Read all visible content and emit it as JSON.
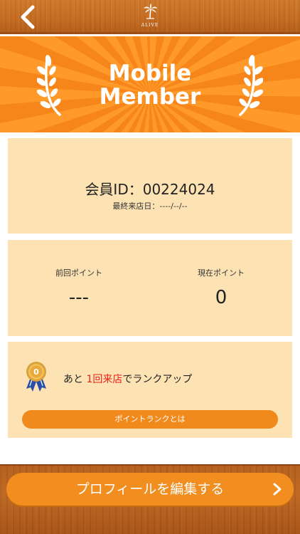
{
  "header": {
    "back_icon": "chevron-left-icon",
    "logo_icon": "palm-tree-icon",
    "logo_text": "ALIVE"
  },
  "banner": {
    "title": "Mobile\nMember",
    "laurel_icon": "laurel-icon"
  },
  "member": {
    "id_text": "会員ID：00224024",
    "last_visit": "最終来店日：----/--/--"
  },
  "points": {
    "previous_label": "前回ポイント",
    "previous_value": "---",
    "current_label": "現在ポイント",
    "current_value": "0"
  },
  "rank": {
    "medal_icon": "medal-icon",
    "medal_number": "0",
    "text_prefix": "あと ",
    "text_highlight": "1回来店",
    "text_suffix": "でランクアップ",
    "button_label": "ポイントランクとは"
  },
  "footer": {
    "profile_button_label": "プロフィールを編集する",
    "chevron_icon": "chevron-right-icon"
  },
  "colors": {
    "accent_orange": "#f18e1f",
    "card_background": "#fde3b4",
    "highlight_red": "#e8231a",
    "wood_brown": "#c46d24"
  }
}
